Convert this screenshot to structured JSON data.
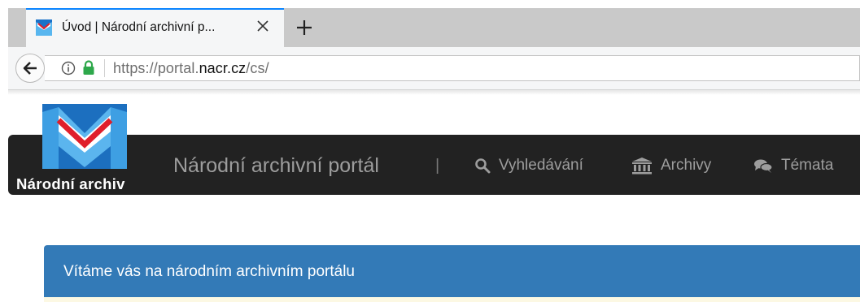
{
  "browser": {
    "tab": {
      "title": "Úvod | Národní archivní p..."
    },
    "address": {
      "url_prefix": "https://portal.",
      "url_domain": "nacr.cz",
      "url_path": "/cs/"
    }
  },
  "header": {
    "logo_text": "Národní archiv",
    "brand": "Národní archivní portál",
    "divider": "|",
    "nav": [
      {
        "label": "Vyhledávání",
        "icon": "search-icon"
      },
      {
        "label": "Archivy",
        "icon": "institution-icon"
      },
      {
        "label": "Témata",
        "icon": "comments-icon"
      }
    ]
  },
  "welcome": {
    "title": "Vítáme vás na národním archivním portálu"
  },
  "colors": {
    "header_bg": "#222222",
    "nav_text": "#9d9d9d",
    "panel_heading": "#337ab7",
    "panel_body": "#fcf8e3",
    "tab_accent": "#0a84ff",
    "lock": "#2ea84b"
  }
}
